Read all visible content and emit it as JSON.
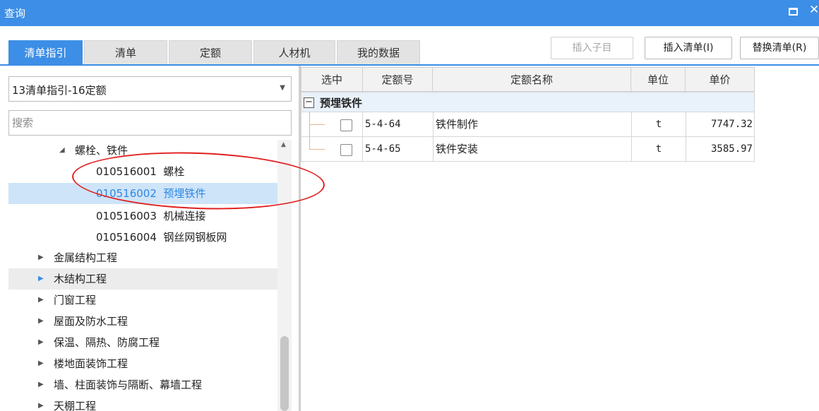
{
  "window": {
    "title": "查询"
  },
  "tabs": [
    {
      "label": "清单指引"
    },
    {
      "label": "清单"
    },
    {
      "label": "定额"
    },
    {
      "label": "人材机"
    },
    {
      "label": "我的数据"
    }
  ],
  "toolbar": {
    "insert_sub_label": "插入子目",
    "insert_list_label": "插入清单(I)",
    "replace_list_label": "替换清单(R)"
  },
  "left_panel": {
    "combo_value": "13清单指引-16定额",
    "search_placeholder": "搜索",
    "tree": [
      {
        "toggle": "◢",
        "label": "螺栓、铁件"
      },
      {
        "toggle": "",
        "label": "010516001  螺栓"
      },
      {
        "toggle": "",
        "label": "010516002  预埋铁件"
      },
      {
        "toggle": "",
        "label": "010516003  机械连接"
      },
      {
        "toggle": "",
        "label": "010516004  钢丝网钢板网"
      },
      {
        "toggle": "▶",
        "label": "金属结构工程"
      },
      {
        "toggle": "▶",
        "label": "木结构工程"
      },
      {
        "toggle": "▶",
        "label": "门窗工程"
      },
      {
        "toggle": "▶",
        "label": "屋面及防水工程"
      },
      {
        "toggle": "▶",
        "label": "保温、隔热、防腐工程"
      },
      {
        "toggle": "▶",
        "label": "楼地面装饰工程"
      },
      {
        "toggle": "▶",
        "label": "墙、柱面装饰与隔断、幕墙工程"
      },
      {
        "toggle": "▶",
        "label": "天棚工程"
      }
    ]
  },
  "grid": {
    "headers": [
      "选中",
      "定额号",
      "定额名称",
      "单位",
      "单价"
    ],
    "group_name": "预埋铁件",
    "group_toggle": "−",
    "rows": [
      {
        "code": "5-4-64",
        "name": "铁件制作",
        "unit": "t",
        "price": "7747.32"
      },
      {
        "code": "5-4-65",
        "name": "铁件安装",
        "unit": "t",
        "price": "3585.97"
      }
    ]
  },
  "icons": {
    "maximize": "maximize-icon",
    "close": "close-icon",
    "dropdown": "chevron-down-icon"
  },
  "colors": {
    "accent": "#3c8ee6",
    "selected_row": "#cde4f9",
    "annotation": "#e02020"
  }
}
